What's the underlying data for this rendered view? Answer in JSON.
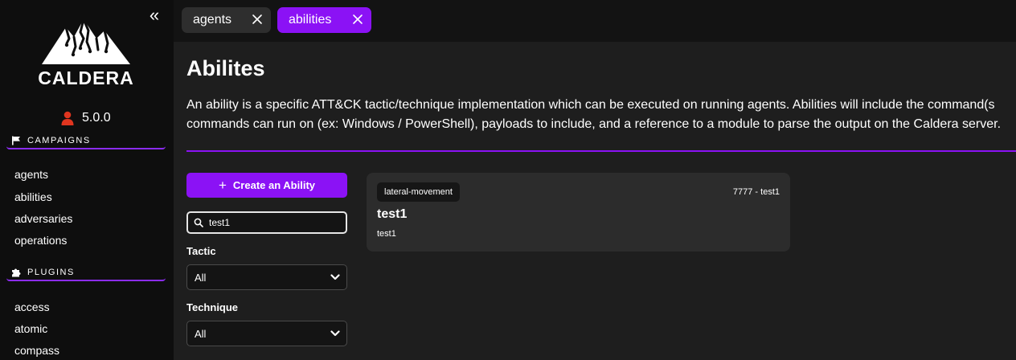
{
  "sidebar": {
    "logo_text": "CALDERA",
    "version": "5.0.0",
    "sections": [
      {
        "title": "CAMPAIGNS",
        "icon": "flag-icon",
        "items": [
          "agents",
          "abilities",
          "adversaries",
          "operations"
        ]
      },
      {
        "title": "PLUGINS",
        "icon": "puzzle-icon",
        "items": [
          "access",
          "atomic",
          "compass"
        ]
      }
    ]
  },
  "tabs": [
    {
      "label": "agents",
      "active": false
    },
    {
      "label": "abilities",
      "active": true
    }
  ],
  "page": {
    "title": "Abilites",
    "description_line1": "An ability is a specific ATT&CK tactic/technique implementation which can be executed on running agents. Abilities will include the command(s",
    "description_line2": "commands can run on (ex: Windows / PowerShell), payloads to include, and a reference to a module to parse the output on the Caldera server."
  },
  "filters": {
    "create_label": "Create an Ability",
    "search_value": "test1",
    "tactic_label": "Tactic",
    "tactic_value": "All",
    "technique_label": "Technique",
    "technique_value": "All"
  },
  "abilities": [
    {
      "tactic": "lateral-movement",
      "id": "7777 - test1",
      "name": "test1",
      "description": "test1"
    }
  ],
  "colors": {
    "accent": "#8b12f5",
    "sidebar_bg": "#0e0e0e",
    "main_bg": "#1e1e1e",
    "card_bg": "#2c2c2c",
    "user_icon": "#e0351f"
  }
}
